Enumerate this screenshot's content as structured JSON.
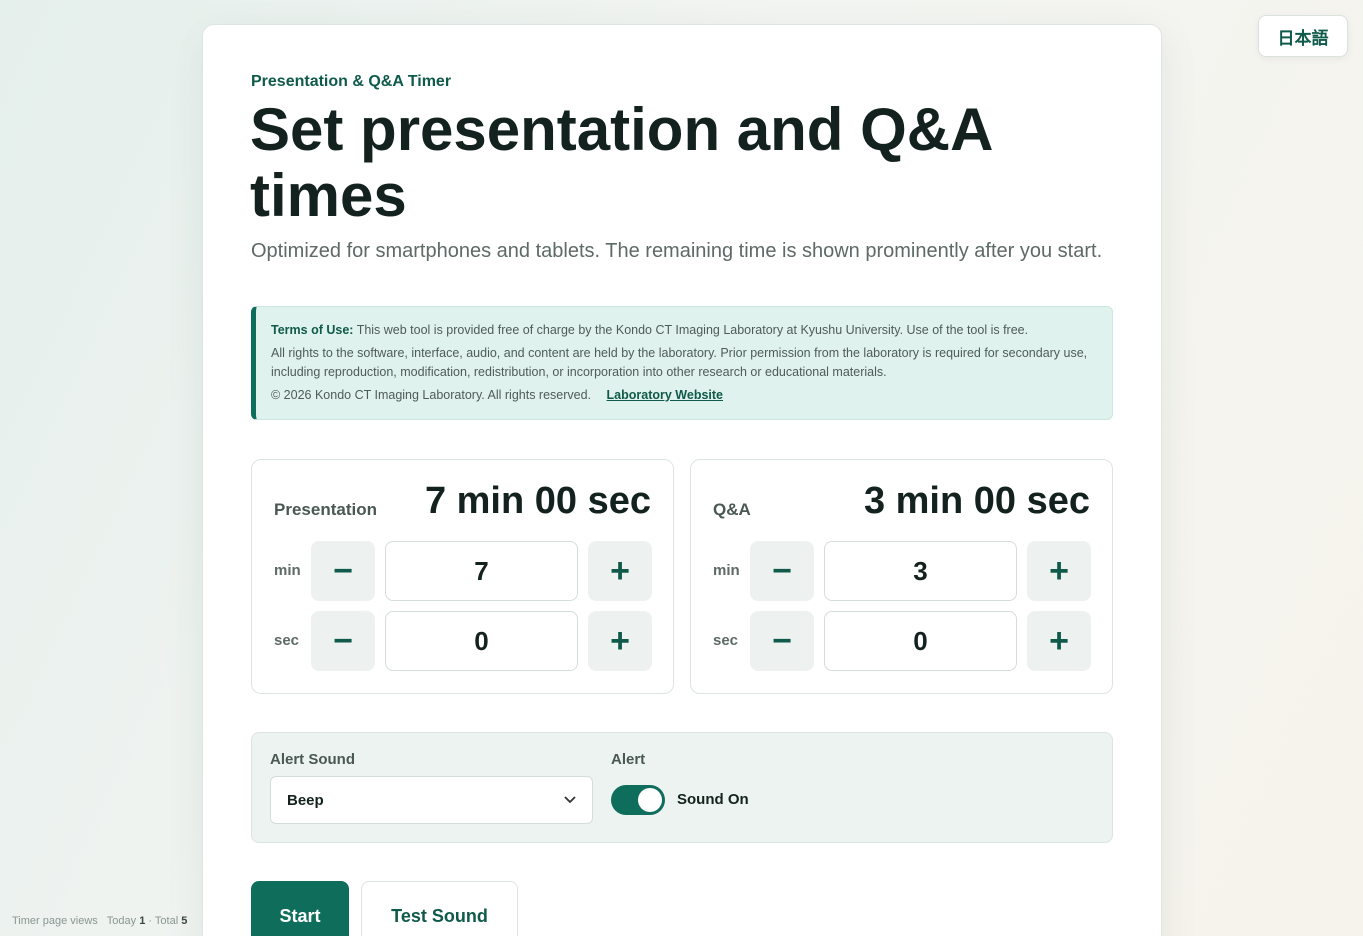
{
  "language_button": "日本語",
  "header": {
    "eyebrow": "Presentation & Q&A Timer",
    "title": "Set presentation and Q&A times",
    "subtitle": "Optimized for smartphones and tablets. The remaining time is shown prominently after you start."
  },
  "terms": {
    "label": "Terms of Use:",
    "line1": "This web tool is provided free of charge by the Kondo CT Imaging Laboratory at Kyushu University. Use of the tool is free.",
    "line2": "All rights to the software, interface, audio, and content are held by the laboratory. Prior permission from the laboratory is required for secondary use, including reproduction, modification, redistribution, or incorporation into other research or educational materials.",
    "copyright": "© 2026 Kondo CT Imaging Laboratory. All rights reserved.",
    "link": "Laboratory Website"
  },
  "presentation": {
    "label": "Presentation",
    "display": "7 min 00 sec",
    "min_unit": "min",
    "sec_unit": "sec",
    "min_value": "7",
    "sec_value": "0"
  },
  "qa": {
    "label": "Q&A",
    "display": "3 min 00 sec",
    "min_unit": "min",
    "sec_unit": "sec",
    "min_value": "3",
    "sec_value": "0"
  },
  "stepper": {
    "minus": "−",
    "plus": "+"
  },
  "settings": {
    "sound_label": "Alert Sound",
    "sound_value": "Beep",
    "alert_label": "Alert",
    "toggle_text": "Sound On",
    "toggle_on": true
  },
  "buttons": {
    "start": "Start",
    "test": "Test Sound"
  },
  "views": {
    "label": "Timer page views",
    "today_label": "Today",
    "today_value": "1",
    "sep": "·",
    "total_label": "Total",
    "total_value": "5"
  },
  "colors": {
    "accent": "#0f6e5b",
    "accent_text": "#0f5a4a",
    "terms_bg": "#e0f2ed"
  },
  "icons": {
    "minus": "minus-icon",
    "plus": "plus-icon",
    "select_chevron": "chevron-down-icon"
  }
}
